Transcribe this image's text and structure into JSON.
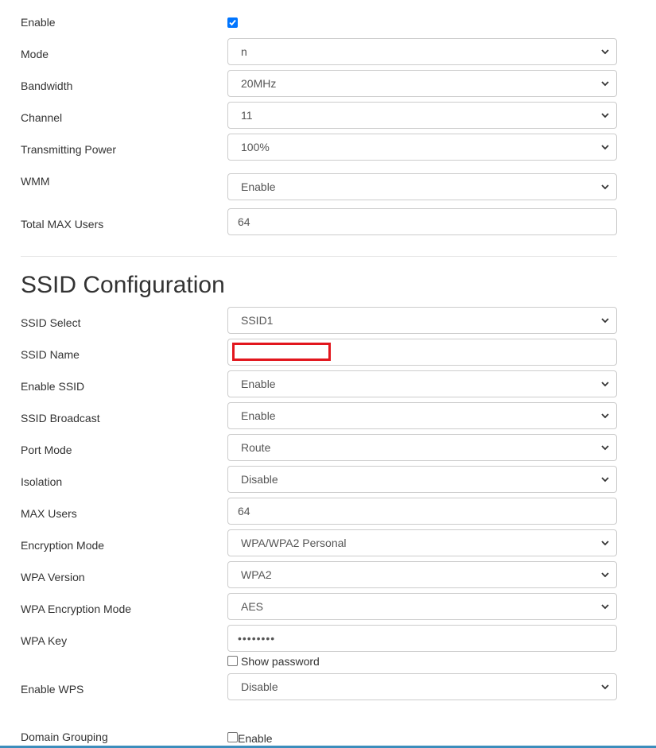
{
  "radio": {
    "enable_label": "Enable",
    "enable_checked": true,
    "mode": {
      "label": "Mode",
      "value": "n"
    },
    "bandwidth": {
      "label": "Bandwidth",
      "value": "20MHz"
    },
    "channel": {
      "label": "Channel",
      "value": "11"
    },
    "tx_power": {
      "label": "Transmitting Power",
      "value": "100%"
    },
    "wmm": {
      "label": "WMM",
      "value": "Enable"
    },
    "total_max_users": {
      "label": "Total MAX Users",
      "value": "64"
    }
  },
  "ssid": {
    "heading": "SSID Configuration",
    "select": {
      "label": "SSID Select",
      "value": "SSID1"
    },
    "name": {
      "label": "SSID Name",
      "value": ""
    },
    "enable": {
      "label": "Enable SSID",
      "value": "Enable"
    },
    "broadcast": {
      "label": "SSID Broadcast",
      "value": "Enable"
    },
    "port_mode": {
      "label": "Port Mode",
      "value": "Route"
    },
    "isolation": {
      "label": "Isolation",
      "value": "Disable"
    },
    "max_users": {
      "label": "MAX Users",
      "value": "64"
    },
    "encryption_mode": {
      "label": "Encryption Mode",
      "value": "WPA/WPA2 Personal"
    },
    "wpa_version": {
      "label": "WPA Version",
      "value": "WPA2"
    },
    "wpa_enc_mode": {
      "label": "WPA Encryption Mode",
      "value": "AES"
    },
    "wpa_key": {
      "label": "WPA Key",
      "value": "••••••••"
    },
    "show_password_label": "Show password",
    "show_password_checked": false,
    "wps": {
      "label": "Enable WPS",
      "value": "Disable"
    },
    "domain_grouping": {
      "label": "Domain Grouping",
      "checkbox_label": "Enable",
      "checked": false
    }
  },
  "colors": {
    "accent": "#0075ff",
    "redaction": "#e2161d",
    "bottom_bar": "#3c8dbc"
  },
  "icons": {
    "select_arrow": "chevron-down-icon",
    "checkbox_check": "check-icon"
  }
}
